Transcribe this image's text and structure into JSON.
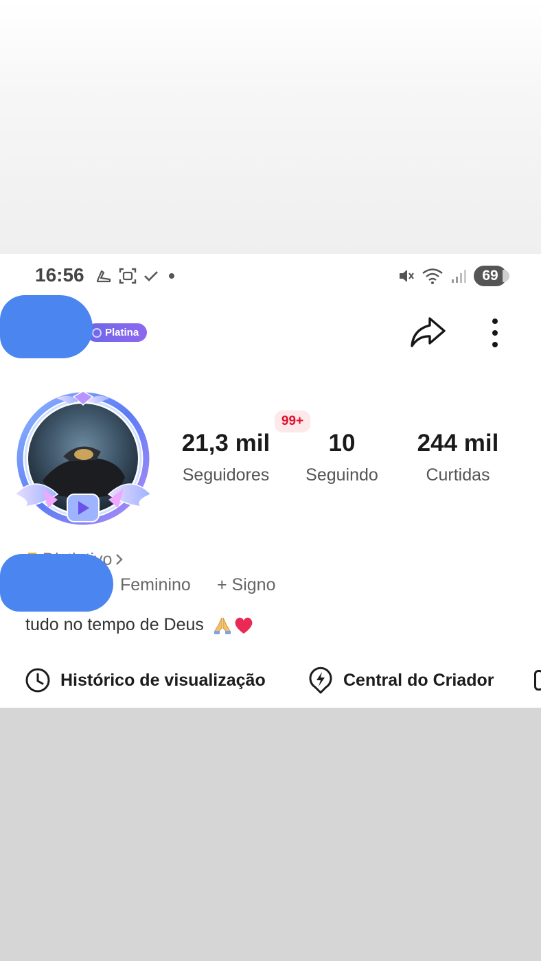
{
  "status_bar": {
    "time": "16:56",
    "battery": "69"
  },
  "header": {
    "badge_label": "Platina"
  },
  "stats": [
    {
      "value": "21,3 mil",
      "label": "Seguidores"
    },
    {
      "value": "10",
      "label": "Seguindo"
    },
    {
      "value": "244 mil",
      "label": "Curtidas"
    }
  ],
  "notification_badge": "99+",
  "profile": {
    "distintivo_label": "Distintivo",
    "gender": "Feminino",
    "sign_label": "+ Signo",
    "bio": "tudo no tempo de Deus"
  },
  "shortcuts": [
    {
      "label": "Histórico de visualização",
      "icon": "clock-icon"
    },
    {
      "label": "Central do Criador",
      "icon": "bolt-pin-icon"
    }
  ],
  "colors": {
    "redaction": "#4a85f0",
    "badge_purple": "#7a67ec",
    "notification_red": "#e2102c"
  }
}
